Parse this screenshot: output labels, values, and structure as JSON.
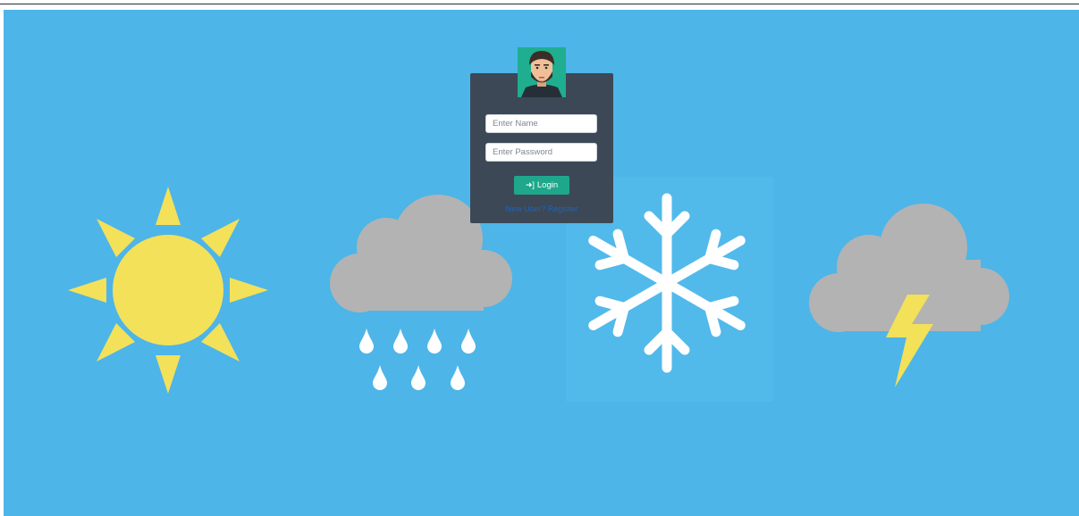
{
  "login": {
    "name_placeholder": "Enter Name",
    "password_placeholder": "Enter Password",
    "login_label": "Login",
    "login_icon": "sign-in-icon",
    "register_link": "New User? Register"
  },
  "weather_icons": [
    "sun-icon",
    "rain-cloud-icon",
    "snowflake-icon",
    "thunderstorm-cloud-icon"
  ],
  "colors": {
    "sky": "#4db5e8",
    "card": "#3c4856",
    "accent": "#1fa78c",
    "sun": "#f3e15a",
    "cloud": "#b3b3b3",
    "snow": "#ffffff",
    "link": "#1a64c4"
  }
}
